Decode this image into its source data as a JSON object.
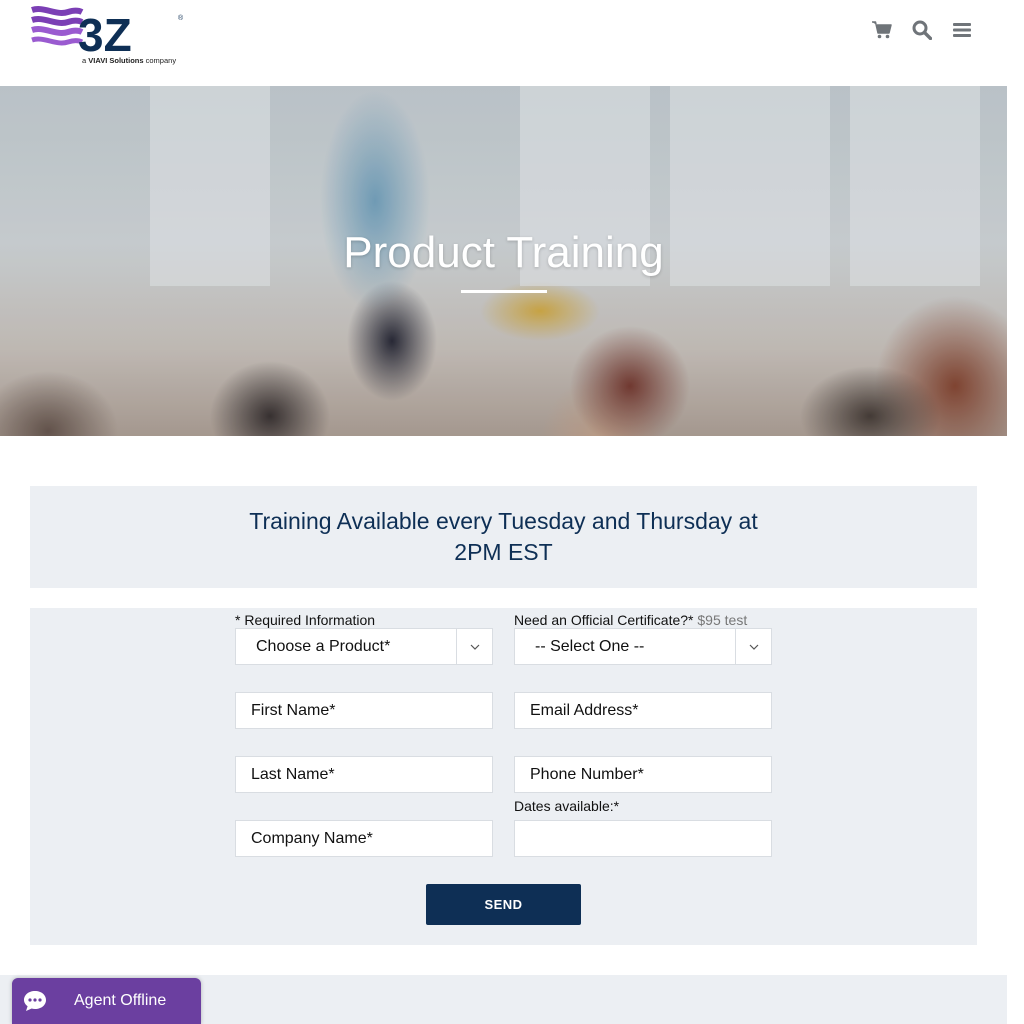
{
  "header": {
    "logo_text": "3Z",
    "logo_tagline_prefix": "a ",
    "logo_tagline_brand": "VIAVI Solutions",
    "logo_tagline_suffix": " company",
    "icons": [
      "cart-icon",
      "search-icon",
      "menu-icon"
    ]
  },
  "hero": {
    "title": "Product Training"
  },
  "banner": {
    "line1": "Training Available every Tuesday and Thursday at",
    "line2": "2PM EST"
  },
  "form": {
    "required_label": "* Required Information",
    "certificate_label": "Need an Official Certificate?*",
    "certificate_note": " $95 test",
    "product_select": "Choose a Product*",
    "certificate_select": "-- Select One --",
    "first_name": "First Name*",
    "email": "Email Address*",
    "last_name": "Last Name*",
    "phone": "Phone Number*",
    "dates_label": "Dates available:*",
    "company": "Company Name*",
    "dates_value": "",
    "send_label": "SEND"
  },
  "chat": {
    "label": "Agent Offline"
  },
  "colors": {
    "navy": "#0e2f55",
    "purple": "#6b3fa0",
    "panel": "#eceff3",
    "icon_gray": "#6f7479"
  }
}
